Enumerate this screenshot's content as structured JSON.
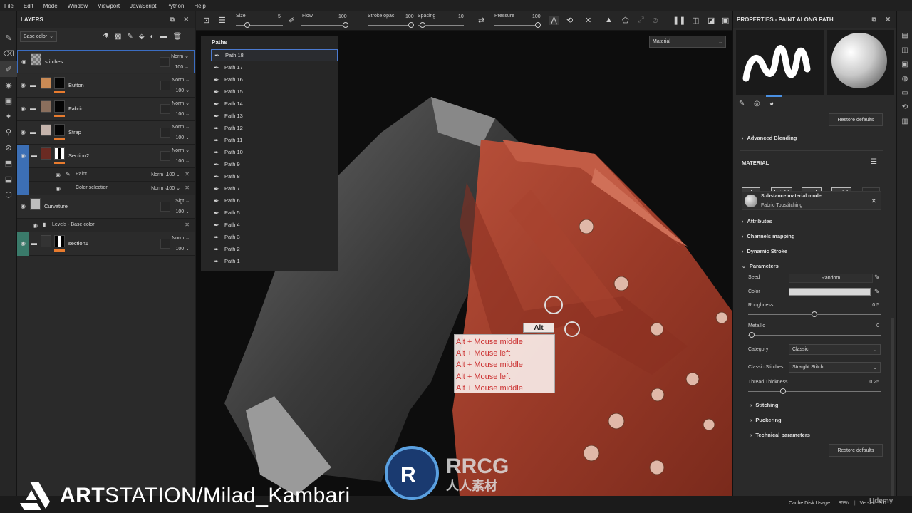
{
  "menubar": [
    "File",
    "Edit",
    "Mode",
    "Window",
    "Viewport",
    "JavaScript",
    "Python",
    "Help"
  ],
  "layers_panel": {
    "title": "LAYERS",
    "channel": "Base color",
    "layers": [
      {
        "name": "stitches",
        "blend": "Norm",
        "opacity": "100"
      },
      {
        "name": "Button",
        "blend": "Norm",
        "opacity": "100"
      },
      {
        "name": "Fabric",
        "blend": "Norm",
        "opacity": "100"
      },
      {
        "name": "Strap",
        "blend": "Norm",
        "opacity": "100"
      },
      {
        "name": "Section2",
        "blend": "Norm",
        "opacity": "100"
      },
      {
        "name": "Curvature",
        "blend": "Slgt",
        "opacity": "100"
      },
      {
        "name": "section1",
        "blend": "Norm",
        "opacity": "100"
      }
    ],
    "sublayers": [
      {
        "name": "Paint",
        "blend": "Norm",
        "opacity": "100"
      },
      {
        "name": "Color selection",
        "blend": "Norm",
        "opacity": "100"
      },
      {
        "name": "Levels - Base color"
      }
    ]
  },
  "toolbar": {
    "size_label": "Size",
    "size_value": "5",
    "flow_label": "Flow",
    "flow_value": "100",
    "stroke_label": "Stroke opac",
    "stroke_value": "100",
    "spacing_label": "Spacing",
    "spacing_value": "10",
    "pressure_label": "Pressure",
    "pressure_value": "100"
  },
  "paths_panel": {
    "title": "Paths",
    "items": [
      "Path 18",
      "Path 17",
      "Path 16",
      "Path 15",
      "Path 14",
      "Path 13",
      "Path 12",
      "Path 11",
      "Path 10",
      "Path 9",
      "Path 8",
      "Path 7",
      "Path 6",
      "Path 5",
      "Path 4",
      "Path 3",
      "Path 2",
      "Path 1"
    ]
  },
  "viewport": {
    "material_mode": "Material",
    "hint_key": "Alt",
    "hints": [
      "Alt + Mouse middle",
      "Alt + Mouse left",
      "Alt + Mouse middle",
      "Alt + Mouse left",
      "Alt + Mouse middle"
    ]
  },
  "properties": {
    "title": "PROPERTIES - PAINT ALONG PATH",
    "restore_defaults": "Restore defaults",
    "advanced_blending": "Advanced Blending",
    "material_title": "MATERIAL",
    "channels": [
      "color",
      "height",
      "rough",
      "metal",
      "nrm"
    ],
    "material_mode_label": "Substance material mode",
    "material_name": "Fabric Topstitching",
    "sections": [
      "Attributes",
      "Channels mapping",
      "Dynamic Stroke",
      "Parameters"
    ],
    "seed_label": "Seed",
    "seed_value": "Random",
    "color_label": "Color",
    "roughness_label": "Roughness",
    "roughness_value": "0.5",
    "metallic_label": "Metallic",
    "metallic_value": "0",
    "category_label": "Category",
    "category_value": "Classic",
    "classic_stitches_label": "Classic Stitches",
    "classic_stitches_value": "Straight Stitch",
    "thread_label": "Thread Thickness",
    "thread_value": "0.25",
    "subsections": [
      "Stitching",
      "Puckering",
      "Technical parameters"
    ],
    "restore_defaults_bottom": "Restore defaults"
  },
  "status": {
    "cache_label": "Cache Disk Usage:",
    "cache_value": "85%",
    "version": "Version: 9.0"
  },
  "watermarks": {
    "artstation_bold": "ART",
    "artstation_rest": "STATION/Milad_Kambari",
    "rrcg_en": "RRCG",
    "rrcg_cn": "人人素材",
    "udemy": "Udemy"
  },
  "colors": {
    "accent_orange": "#e87b2e",
    "selection_blue": "#3b6dc2",
    "hint_red": "#cc3333"
  }
}
